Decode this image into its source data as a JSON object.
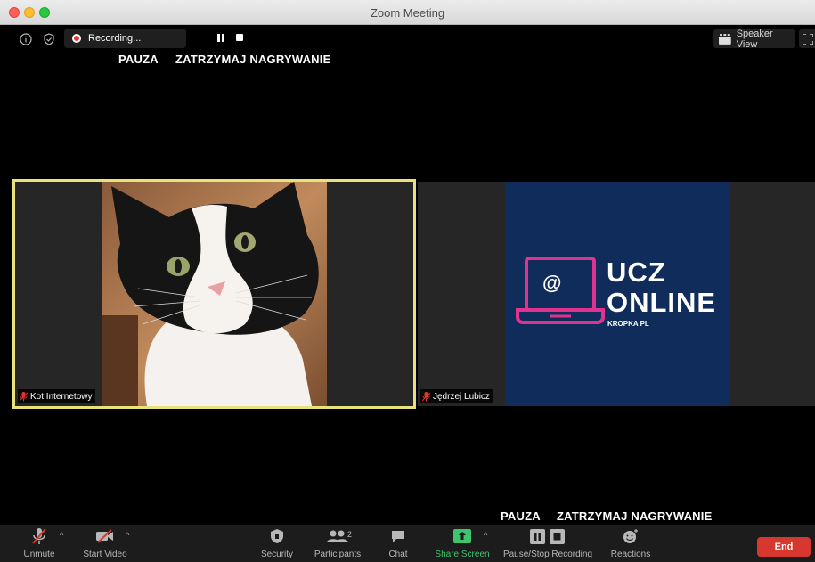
{
  "window": {
    "title": "Zoom Meeting"
  },
  "top_bar": {
    "recording_label": "Recording...",
    "speaker_view_label": "Speaker View"
  },
  "annotations": {
    "top": {
      "pause": "PAUZA",
      "stop": "ZATRZYMAJ NAGRYWANIE"
    },
    "bottom": {
      "pause": "PAUZA",
      "stop": "ZATRZYMAJ NAGRYWANIE"
    }
  },
  "participants": [
    {
      "name": "Kot Internetowy",
      "video": "cat-photo",
      "active_speaker": true,
      "muted": true
    },
    {
      "name": "Jędrzej Lubicz",
      "video": "ucz-online-logo",
      "active_speaker": false,
      "muted": true
    }
  ],
  "logo": {
    "line1": "UCZ",
    "line2": "ONLINE",
    "line3": "KROPKA PL",
    "icon_glyph": "@"
  },
  "toolbar": {
    "unmute": "Unmute",
    "start_video": "Start Video",
    "security": "Security",
    "participants": "Participants",
    "participants_count": "2",
    "chat": "Chat",
    "share_screen": "Share Screen",
    "pause_stop_recording": "Pause/Stop Recording",
    "reactions": "Reactions",
    "end": "End"
  },
  "colors": {
    "active_speaker_border": "#e8e27a",
    "share_green": "#3ec46d",
    "end_red": "#d6372f",
    "logo_bg": "#0f2c5a",
    "logo_pink": "#e0338f",
    "mute_red": "#e0362c"
  },
  "icons": [
    "info-icon",
    "shield-check-icon",
    "record-icon",
    "pause-icon",
    "stop-icon",
    "speaker-view-icon",
    "fullscreen-icon",
    "microphone-muted-icon",
    "video-off-icon",
    "caret-up-icon",
    "security-shield-icon",
    "participants-icon",
    "chat-icon",
    "share-screen-icon",
    "pause-stop-recording-icon",
    "reactions-icon"
  ]
}
